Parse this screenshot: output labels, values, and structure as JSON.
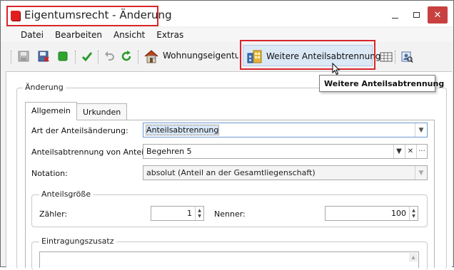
{
  "window": {
    "title": "Eigentumsrecht - Änderung",
    "controls": {
      "minimize": "—",
      "maximize": "□",
      "close": "✕"
    }
  },
  "menu": {
    "items": [
      "Datei",
      "Bearbeiten",
      "Ansicht",
      "Extras"
    ]
  },
  "toolbar": {
    "wohnung_label": "Wohnungseigentum",
    "weitere_label": "Weitere Anteilsabtrennung",
    "tooltip": "Weitere Anteilsabtrennung"
  },
  "group_aenderung": {
    "title": "Änderung"
  },
  "tabs": [
    {
      "label": "Allgemein",
      "active": true
    },
    {
      "label": "Urkunden",
      "active": false
    }
  ],
  "form": {
    "art_label": "Art der Anteilsänderung:",
    "art_value": "Anteilsabtrennung",
    "von_anteil_label": "Anteilsabtrennung von Anteil:",
    "von_anteil_value": "Begehren 5",
    "notation_label": "Notation:",
    "notation_value": "absolut (Anteil an der Gesamtliegenschaft)"
  },
  "anteilsgroesse": {
    "title": "Anteilsgröße",
    "zaehler_label": "Zähler:",
    "zaehler_value": "1",
    "nenner_label": "Nenner:",
    "nenner_value": "100"
  },
  "eintragungszusatz": {
    "title": "Eintragungszusatz"
  },
  "colors": {
    "highlight": "#d9262c",
    "accent": "#dbe8f6"
  }
}
